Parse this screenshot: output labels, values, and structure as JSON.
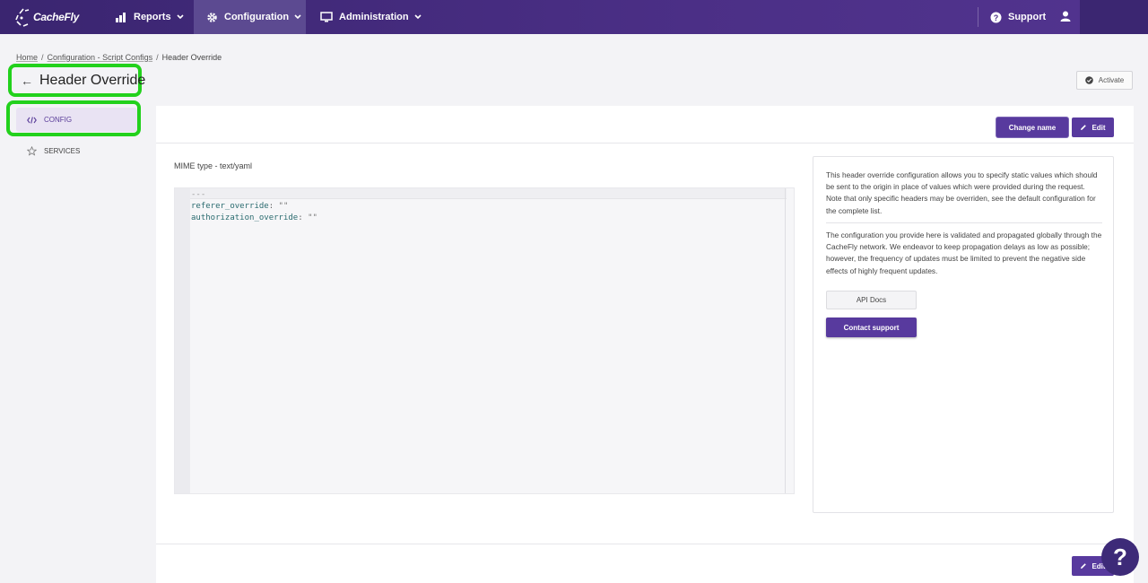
{
  "brand": {
    "name": "CacheFly"
  },
  "nav": {
    "reports": "Reports",
    "configuration": "Configuration",
    "administration": "Administration",
    "support": "Support"
  },
  "breadcrumb": {
    "home": "Home",
    "script_configs": "Configuration - Script Configs",
    "current": "Header Override"
  },
  "page": {
    "title": "Header Override",
    "activate_label": "Activate"
  },
  "sidebar": {
    "items": [
      {
        "label": "CONFIG",
        "icon": "code-icon",
        "active": true
      },
      {
        "label": "SERVICES",
        "icon": "star-icon",
        "active": false
      }
    ]
  },
  "card": {
    "change_name_label": "Change name",
    "edit_label": "Edit",
    "mime_type": "MIME type - text/yaml"
  },
  "editor": {
    "lines": [
      {
        "key": "---",
        "rest": ""
      },
      {
        "key": "referer_override",
        "rest": "\"\""
      },
      {
        "key": "authorization_override",
        "rest": "\"\""
      }
    ]
  },
  "info": {
    "paragraph1": "This header override configuration allows you to specify static values which should be sent to the origin in place of values which were provided during the request. Note that only specific headers may be overriden, see the default configuration for the complete list.",
    "paragraph2": "The configuration you provide here is validated and propagated globally through the CacheFly network. We endeavor to keep propagation delays as low as possible; however, the frequency of updates must be limited to prevent the negative side effects of highly frequent updates.",
    "api_docs_label": "API Docs",
    "contact_support_label": "Contact support"
  },
  "help": {
    "label": "?"
  },
  "colors": {
    "primary": "#583a9e",
    "topbar": "#4b2f86",
    "highlight": "#22d11c"
  }
}
